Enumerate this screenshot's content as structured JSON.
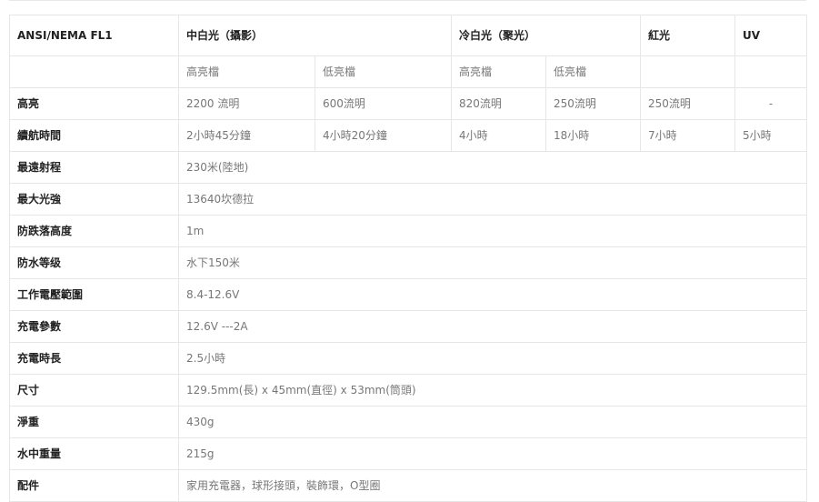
{
  "header": {
    "model": "ANSI/NEMA FL1",
    "group_white": "中白光（攝影）",
    "group_cold": "冷白光（聚光）",
    "group_red": "紅光",
    "group_uv": "UV"
  },
  "subheader": {
    "white_high": "高亮檔",
    "white_low": "低亮檔",
    "cold_high": "高亮檔",
    "cold_low": "低亮檔"
  },
  "rows": {
    "brightness": {
      "label": "高亮",
      "white_high": "2200 流明",
      "white_low": "600流明",
      "cold_high": "820流明",
      "cold_low": "250流明",
      "red": "250流明",
      "uv": "-"
    },
    "runtime": {
      "label": "續航時間",
      "white_high": "2小時45分鐘",
      "white_low": "4小時20分鐘",
      "cold_high": "4小時",
      "cold_low": "18小時",
      "red": "7小時",
      "uv": "5小時"
    },
    "specs": [
      {
        "label": "最遠射程",
        "value": "230米(陸地)"
      },
      {
        "label": "最大光強",
        "value": "13640坎德拉"
      },
      {
        "label": "防跌落高度",
        "value": "1m"
      },
      {
        "label": "防水等级",
        "value": "水下150米"
      },
      {
        "label": "工作電壓範圍",
        "value": "8.4-12.6V"
      },
      {
        "label": "充電參數",
        "value": "12.6V ---2A"
      },
      {
        "label": "充電時長",
        "value": "2.5小時"
      },
      {
        "label": "尺寸",
        "value": "129.5mm(長) x 45mm(直徑) x 53mm(筒頭)"
      },
      {
        "label": "淨重",
        "value": "430g"
      },
      {
        "label": "水中重量",
        "value": "215g"
      },
      {
        "label": "配件",
        "value": "家用充電器，球形接頭，裝飾環，O型圈"
      }
    ]
  }
}
